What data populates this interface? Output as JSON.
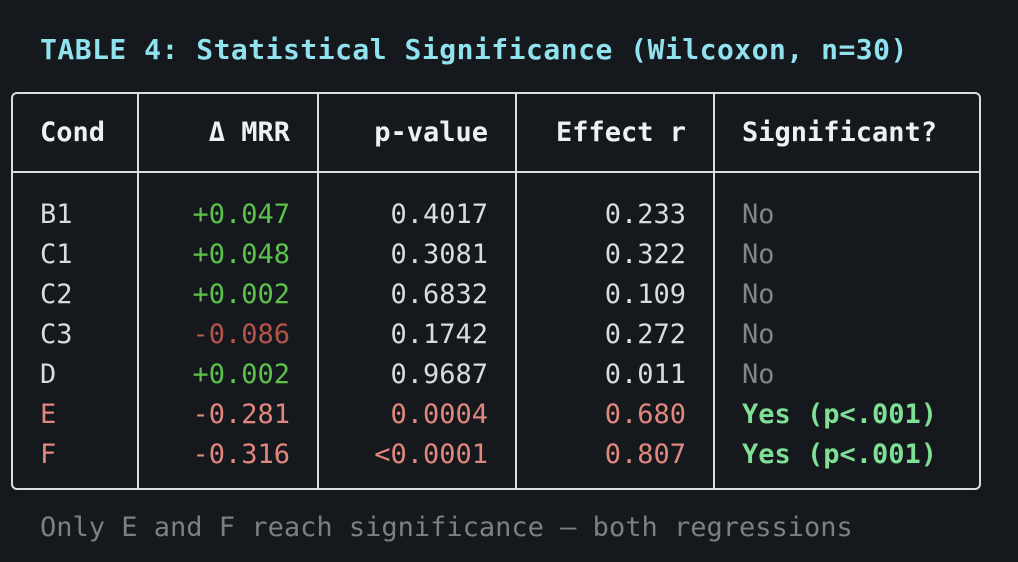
{
  "title": "TABLE 4: Statistical Significance (Wilcoxon, n=30)",
  "headers": [
    "Cond",
    "Δ MRR",
    "p-value",
    "Effect r",
    "Significant?"
  ],
  "rows": [
    {
      "cond": "B1",
      "delta": "+0.047",
      "p": "0.4017",
      "r": "0.233",
      "sig": "No",
      "delta_style": "pos",
      "row_style": "plain",
      "sig_style": "no"
    },
    {
      "cond": "C1",
      "delta": "+0.048",
      "p": "0.3081",
      "r": "0.322",
      "sig": "No",
      "delta_style": "pos",
      "row_style": "plain",
      "sig_style": "no"
    },
    {
      "cond": "C2",
      "delta": "+0.002",
      "p": "0.6832",
      "r": "0.109",
      "sig": "No",
      "delta_style": "pos",
      "row_style": "plain",
      "sig_style": "no"
    },
    {
      "cond": "C3",
      "delta": "-0.086",
      "p": "0.1742",
      "r": "0.272",
      "sig": "No",
      "delta_style": "neg-muted",
      "row_style": "plain",
      "sig_style": "no"
    },
    {
      "cond": "D",
      "delta": "+0.002",
      "p": "0.9687",
      "r": "0.011",
      "sig": "No",
      "delta_style": "pos",
      "row_style": "plain",
      "sig_style": "no"
    },
    {
      "cond": "E",
      "delta": "-0.281",
      "p": "0.0004",
      "r": "0.680",
      "sig": "Yes (p<.001)",
      "delta_style": "neg",
      "row_style": "neg",
      "sig_style": "yes"
    },
    {
      "cond": "F",
      "delta": "-0.316",
      "p": "<0.0001",
      "r": "0.807",
      "sig": "Yes (p<.001)",
      "delta_style": "neg",
      "row_style": "neg",
      "sig_style": "yes"
    }
  ],
  "footer": "Only E and F reach significance — both regressions",
  "colors": {
    "background": "#15181c",
    "title": "#8fe2ee",
    "positive": "#5cc24a",
    "negative": "#e2877d",
    "negative_muted": "#b5554a",
    "significant": "#7edf95",
    "not_significant": "#80858c",
    "border": "#d9dde2"
  }
}
